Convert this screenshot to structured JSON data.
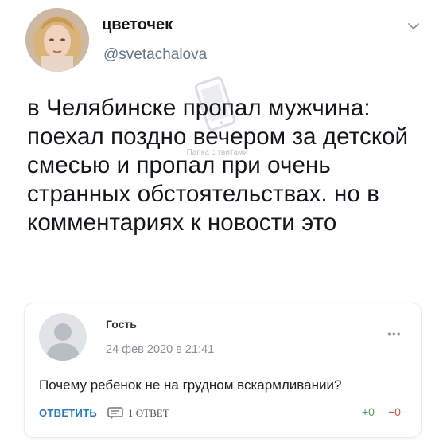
{
  "tweet": {
    "display_name": "цветочек",
    "handle": "@svetachalova",
    "text": "в Челябинске пропал мужчина: поехал поздно вечером за детской смесью и пропал при очень странных обстоятельствах. но в комментариях к новости это",
    "menu_icon": "chevron-down-icon",
    "avatar_icon": "user-avatar"
  },
  "watermark": {
    "text": "Папка с твитами",
    "icon": "phone-icon"
  },
  "comment": {
    "author": "Гость",
    "date": "24 фев 2020 в 21:41",
    "text": "Почему ребенок не на грудном вскармливании?",
    "reply_label": "ОТВЕТИТЬ",
    "replies_label": "1 ОТВЕТ",
    "votes_up": "+0",
    "votes_down": "−0",
    "more_label": "•••",
    "colors": {
      "reply": "#2a7ab8",
      "up": "#3aa24a",
      "down": "#e04a3a"
    }
  }
}
